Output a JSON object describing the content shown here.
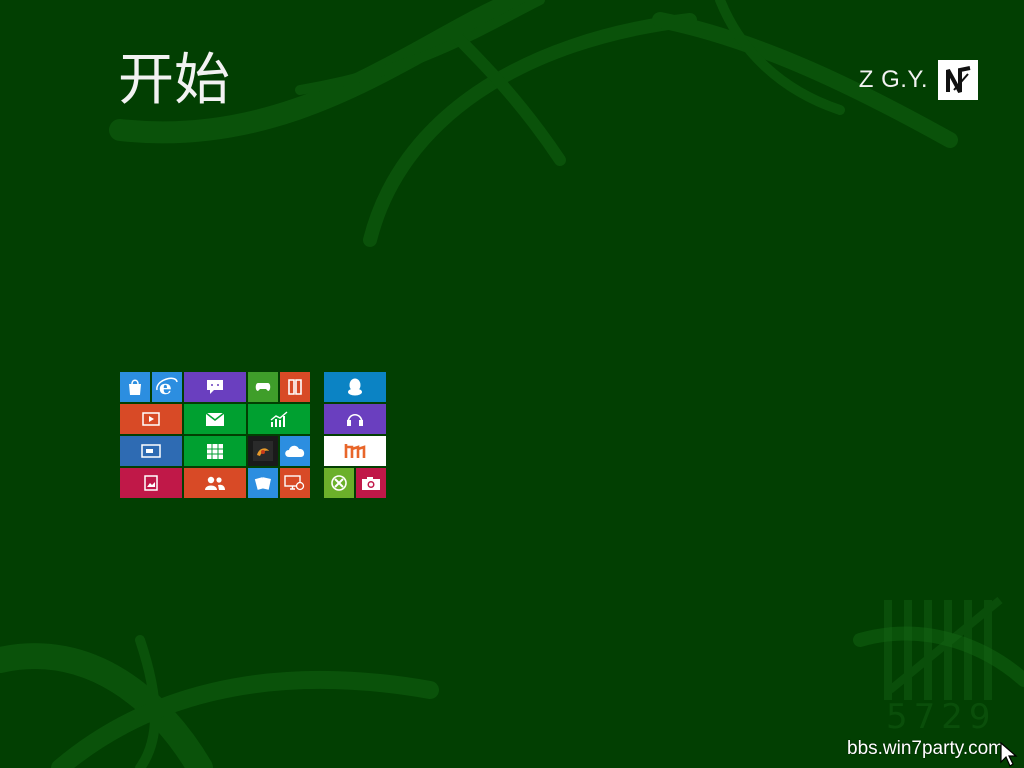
{
  "screen": {
    "title": "开始",
    "user_name": "Z G.Y.",
    "avatar_icon": "zigzag-logo-avatar",
    "footer_text": "bbs.win7party.com",
    "background_color": "#023f02"
  },
  "tiles": [
    {
      "name": "store-tile",
      "icon": "shopping-bag-icon",
      "color": "#2c8ee0"
    },
    {
      "name": "internet-explorer-tile",
      "icon": "internet-explorer-icon",
      "color": "#2c8ee0"
    },
    {
      "name": "messaging-tile",
      "icon": "chat-bubble-icon",
      "color": "#6a3fbf"
    },
    {
      "name": "games-tile",
      "icon": "gamepad-icon",
      "color": "#3f9e2a"
    },
    {
      "name": "reader-tile",
      "icon": "document-reader-icon",
      "color": "#d84a26"
    },
    {
      "name": "video-tile",
      "icon": "video-play-icon",
      "color": "#d84a26"
    },
    {
      "name": "mail-tile",
      "icon": "mail-envelope-icon",
      "color": "#00a030"
    },
    {
      "name": "finance-tile",
      "icon": "finance-chart-icon",
      "color": "#00a030"
    },
    {
      "name": "remote-desktop-tile",
      "icon": "remote-desktop-icon",
      "color": "#2e6bb3"
    },
    {
      "name": "calendar-tile",
      "icon": "calendar-grid-icon",
      "color": "#00a030"
    },
    {
      "name": "app-tile",
      "icon": "app-logo-icon",
      "color": "#1a1a1a"
    },
    {
      "name": "skydrive-tile",
      "icon": "cloud-icon",
      "color": "#2c8ee0"
    },
    {
      "name": "photos-tile",
      "icon": "photo-frame-icon",
      "color": "#c01848"
    },
    {
      "name": "people-tile",
      "icon": "people-icon",
      "color": "#d84a26"
    },
    {
      "name": "solitaire-tile",
      "icon": "playing-cards-icon",
      "color": "#2c8ee0"
    },
    {
      "name": "desktop-tile",
      "icon": "desktop-settings-icon",
      "color": "#d84a26"
    },
    {
      "name": "qq-tile",
      "icon": "penguin-icon",
      "color": "#0b83c4"
    },
    {
      "name": "music-tile",
      "icon": "headphones-icon",
      "color": "#6a3fbf"
    },
    {
      "name": "maxthon-tile",
      "icon": "maxthon-m-icon",
      "color": "#ffffff"
    },
    {
      "name": "xbox-tile",
      "icon": "xbox-icon",
      "color": "#6bb02a"
    },
    {
      "name": "camera-tile",
      "icon": "camera-icon",
      "color": "#c01848"
    }
  ]
}
